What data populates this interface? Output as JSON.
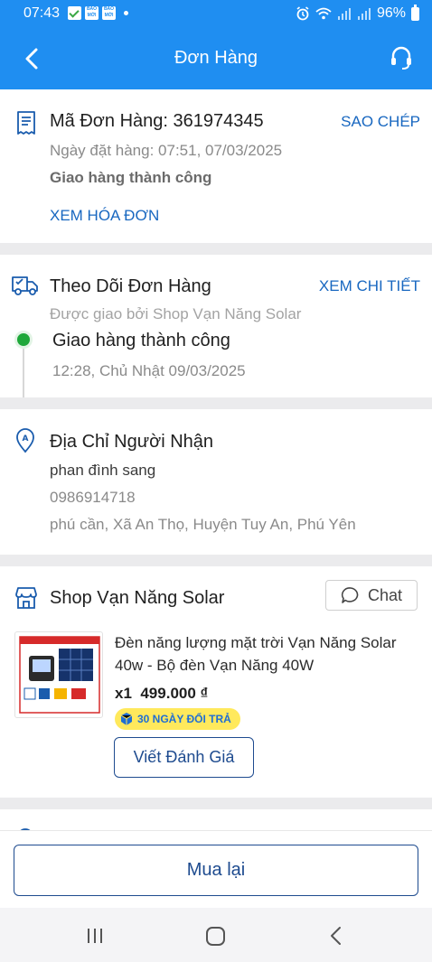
{
  "status_bar": {
    "time": "07:43",
    "battery": "96%",
    "chip1": "BÁO MỚI",
    "chip2": "BÁO MỚI"
  },
  "header": {
    "title": "Đơn Hàng"
  },
  "order": {
    "code_label": "Mã Đơn Hàng: 361974345",
    "copy_label": "SAO CHÉP",
    "date": "Ngày đặt hàng: 07:51, 07/03/2025",
    "status": "Giao hàng thành công",
    "invoice_link": "XEM HÓA ĐƠN"
  },
  "tracking": {
    "title": "Theo Dõi Đơn Hàng",
    "detail_link": "XEM CHI TIẾT",
    "carrier": "Được giao bởi Shop Vạn Năng Solar",
    "status": "Giao hàng thành công",
    "time": "12:28, Chủ Nhật 09/03/2025"
  },
  "address": {
    "title": "Địa Chỉ Người Nhận",
    "name": "phan đình sang",
    "phone": "0986914718",
    "location": "phú cần, Xã An Thọ, Huyện Tuy An, Phú Yên"
  },
  "shop": {
    "name": "Shop Vạn Năng Solar",
    "chat_label": "Chat",
    "product": {
      "title_line1": "Đèn năng lượng mặt trời Vạn Năng Solar",
      "title_line2": "40w - Bộ đèn Vạn Năng 40W",
      "qty_price": "x1  499.000 ₫",
      "return_badge": "30 NGÀY ĐỔI TRẢ",
      "review_label": "Viết Đánh Giá"
    }
  },
  "footer": {
    "rebuy_label": "Mua lại"
  },
  "colors": {
    "primary": "#1f8ef1",
    "link": "#1867c0",
    "button_border": "#1e4b8f",
    "success": "#1ea83a",
    "badge_bg": "#ffe95c"
  }
}
